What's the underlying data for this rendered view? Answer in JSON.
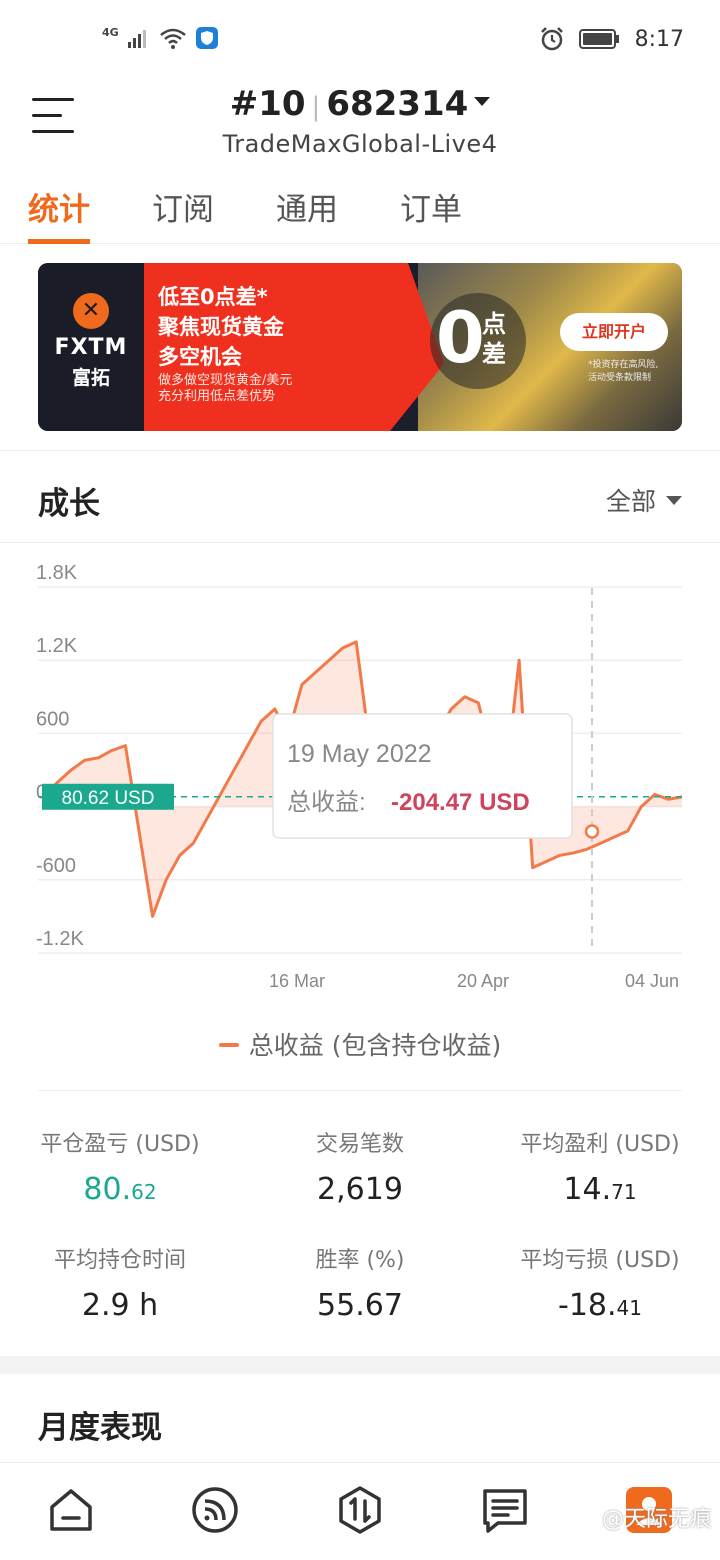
{
  "status_bar": {
    "network": "4G",
    "time": "8:17"
  },
  "header": {
    "account_prefix": "#10",
    "account_number": "682314",
    "server": "TradeMaxGlobal-Live4"
  },
  "tabs": [
    {
      "label": "统计",
      "active": true
    },
    {
      "label": "订阅",
      "active": false
    },
    {
      "label": "通用",
      "active": false
    },
    {
      "label": "订单",
      "active": false
    }
  ],
  "banner": {
    "brand": "FXTM",
    "brand_cn": "富拓",
    "line1": "低至0点差*",
    "line2": "聚焦现货黄金",
    "line3": "多空机会",
    "sub1": "做多做空现货黄金/美元",
    "sub2": "充分利用低点差优势",
    "zero": "0",
    "zero_label1": "点",
    "zero_label2": "差",
    "cta": "立即开户",
    "note1": "*投资存在高风险,",
    "note2": "活动受条款限制"
  },
  "growth": {
    "title": "成长",
    "filter": "全部"
  },
  "chart_data": {
    "type": "area",
    "y_ticks": [
      "1.8K",
      "1.2K",
      "600",
      "0",
      "-600",
      "-1.2K"
    ],
    "x_ticks": [
      "16 Mar",
      "20 Apr",
      "04 Jun"
    ],
    "ylim": [
      -1200,
      1800
    ],
    "current_line_label": "80.62 USD",
    "current_value": 80.62,
    "series": [
      {
        "name": "总收益 (包含持仓收益)",
        "color": "#f27a4a",
        "values": [
          80,
          200,
          300,
          380,
          400,
          460,
          500,
          -200,
          -900,
          -600,
          -400,
          -300,
          -100,
          100,
          300,
          500,
          700,
          800,
          600,
          1000,
          1100,
          1200,
          1300,
          1350,
          500,
          -100,
          100,
          200,
          350,
          600,
          800,
          900,
          850,
          400,
          200,
          1200,
          -500,
          -450,
          -400,
          -380,
          -350,
          -300,
          -250,
          -200,
          0,
          100,
          60,
          80
        ]
      }
    ],
    "tooltip": {
      "date": "19 May 2022",
      "label": "总收益:",
      "value": "-204.47 USD"
    }
  },
  "legend": {
    "label": "总收益 (包含持仓收益)"
  },
  "stats": [
    {
      "label": "平仓盈亏 (USD)",
      "int": "80.",
      "dec": "62",
      "positive": true
    },
    {
      "label": "交易笔数",
      "int": "2,619",
      "dec": "",
      "positive": false
    },
    {
      "label": "平均盈利 (USD)",
      "int": "14.",
      "dec": "71",
      "positive": false
    },
    {
      "label": "平均持仓时间",
      "int": "2.9 h",
      "dec": "",
      "positive": false
    },
    {
      "label": "胜率 (%)",
      "int": "55.67",
      "dec": "",
      "positive": false
    },
    {
      "label": "平均亏损 (USD)",
      "int": "-18.",
      "dec": "41",
      "positive": false
    }
  ],
  "monthly": {
    "title": "月度表现"
  },
  "watermark": "@天际无痕"
}
